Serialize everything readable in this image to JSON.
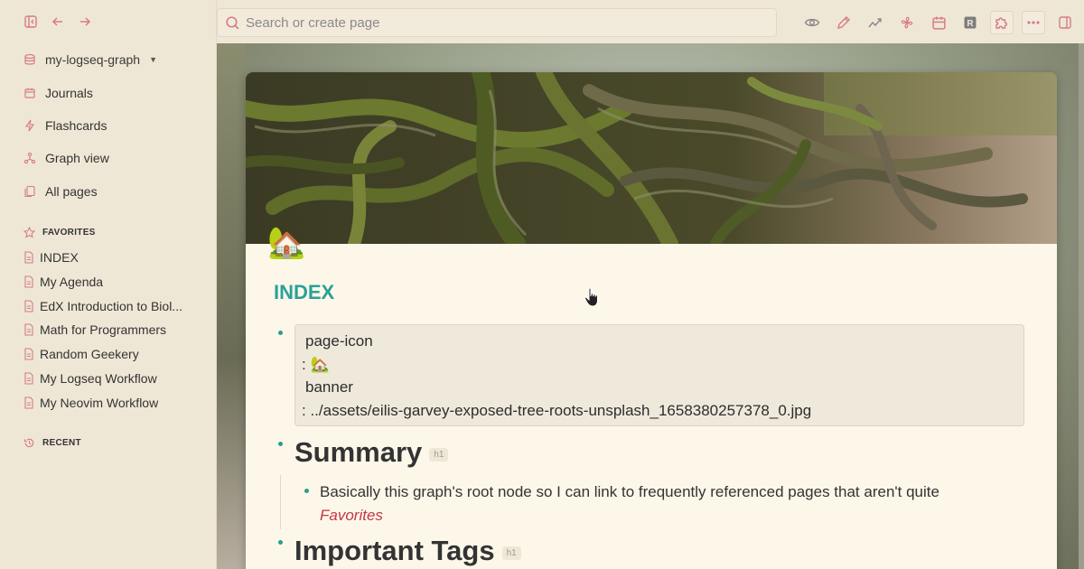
{
  "sidebar": {
    "graph_name": "my-logseq-graph",
    "nav": [
      {
        "label": "Journals",
        "icon": "calendar-icon"
      },
      {
        "label": "Flashcards",
        "icon": "flashcards-icon"
      },
      {
        "label": "Graph view",
        "icon": "graph-icon"
      },
      {
        "label": "All pages",
        "icon": "pages-icon"
      }
    ],
    "favorites_title": "FAVORITES",
    "favorites": [
      {
        "label": "INDEX"
      },
      {
        "label": "My Agenda"
      },
      {
        "label": "EdX Introduction to Biol..."
      },
      {
        "label": "Math for Programmers"
      },
      {
        "label": "Random Geekery"
      },
      {
        "label": "My Logseq Workflow"
      },
      {
        "label": "My Neovim Workflow"
      }
    ],
    "recent_title": "RECENT"
  },
  "topbar": {
    "search_placeholder": "Search or create page"
  },
  "page": {
    "icon": "🏡",
    "title": "INDEX",
    "properties": {
      "key1": "page-icon",
      "val1": ": 🏡",
      "key2": "banner",
      "val2": ": ../assets/eilis-garvey-exposed-tree-roots-unsplash_1658380257378_0.jpg"
    },
    "heading1": "Summary",
    "heading1_tag": "h1",
    "summary_text": "Basically this graph's root node so I can link to frequently referenced pages that aren't quite",
    "summary_link": "Favorites",
    "heading2": "Important Tags",
    "heading2_tag": "h1"
  },
  "colors": {
    "accent": "#2aa198",
    "icon": "#d67b85",
    "link": "#c1364a"
  }
}
